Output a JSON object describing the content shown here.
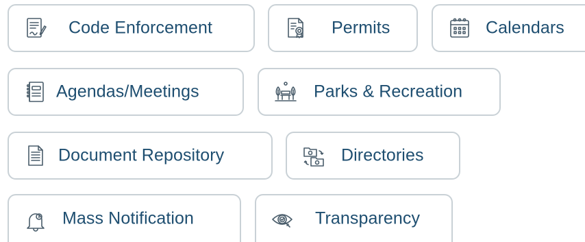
{
  "buttons": [
    {
      "label": "Code Enforcement",
      "icon": "code-enforcement-icon"
    },
    {
      "label": "Permits",
      "icon": "permit-certificate-icon"
    },
    {
      "label": "Calendars",
      "icon": "calendar-icon"
    },
    {
      "label": "Agendas/Meetings",
      "icon": "notebook-icon"
    },
    {
      "label": "Parks & Recreation",
      "icon": "park-bench-icon"
    },
    {
      "label": "Document Repository",
      "icon": "document-icon"
    },
    {
      "label": "Directories",
      "icon": "folders-icon"
    },
    {
      "label": "Mass Notification",
      "icon": "bell-icon"
    },
    {
      "label": "Transparency",
      "icon": "eye-magnifier-icon"
    }
  ],
  "colors": {
    "text": "#1e4e70",
    "border": "#c9d1d6",
    "icon": "#4a5d6b"
  }
}
